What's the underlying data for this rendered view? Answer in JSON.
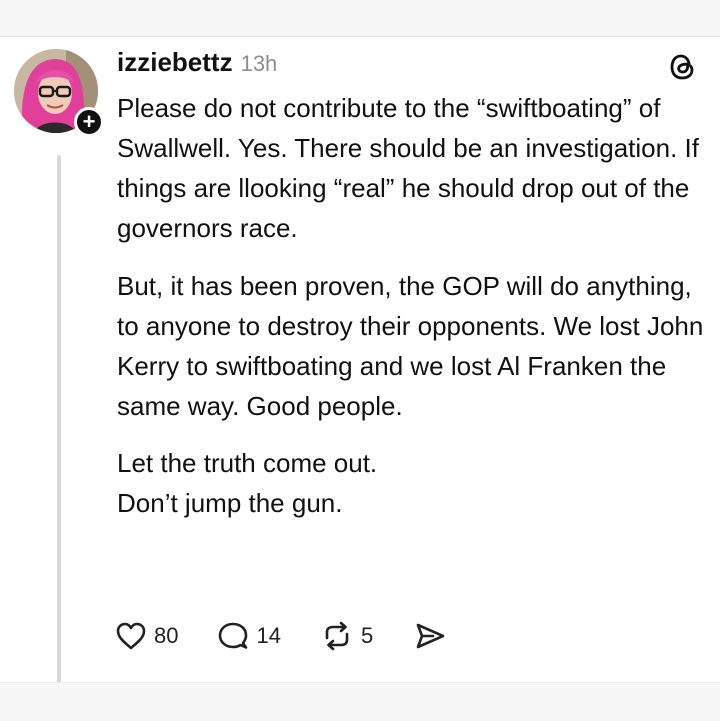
{
  "post": {
    "username": "izziebettz",
    "timestamp": "13h",
    "follow_badge": "+",
    "paragraphs": {
      "p1": "Please do not contribute to the “swiftboating” of Swallwell. Yes. There should be an investigation. If things are llooking “real” he should drop out of the governors race.",
      "p2": "But, it has been proven, the GOP will do anything, to anyone to destroy their opponents. We lost John Kerry to swiftboating and we lost Al Franken the same way. Good people.",
      "p3_line1": "Let the truth come out.",
      "p3_line2": "Don’t jump the gun."
    }
  },
  "actions": {
    "likes": "80",
    "replies": "14",
    "reposts": "5"
  },
  "icons": {
    "brand": "threads-logo-icon",
    "like": "heart-icon",
    "reply": "comment-bubble-icon",
    "repost": "repost-arrows-icon",
    "share": "send-icon"
  },
  "colors": {
    "text": "#111111",
    "muted": "#8e8e8e",
    "thread_line": "#d9d9d9",
    "avatar_hair": "#e0409a"
  }
}
